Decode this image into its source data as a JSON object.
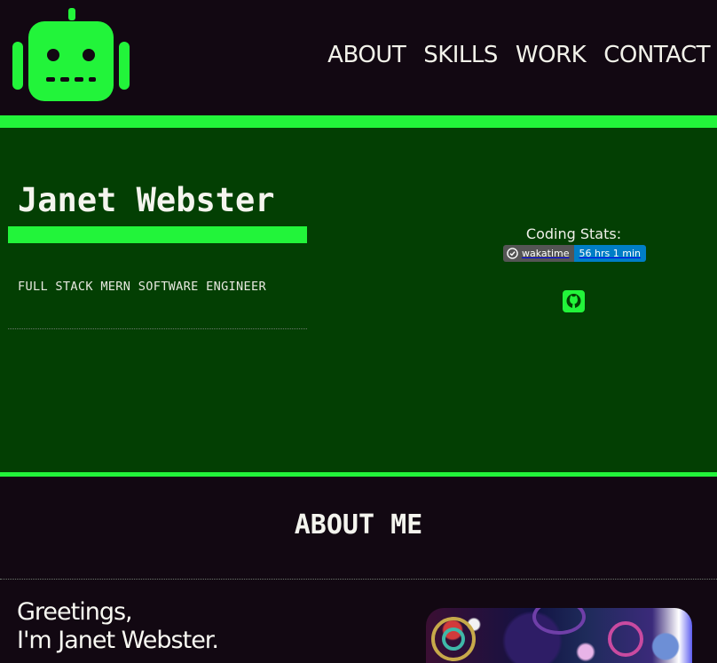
{
  "nav": {
    "items": [
      "ABOUT",
      "SKILLS",
      "WORK",
      "CONTACT"
    ]
  },
  "hero": {
    "name": "Janet Webster",
    "role": "FULL STACK MERN SOFTWARE ENGINEER",
    "stats_label": "Coding Stats:",
    "badge_left": "wakatime",
    "badge_right": "56 hrs 1 min"
  },
  "about": {
    "title": "ABOUT ME",
    "greeting_line1": "Greetings,",
    "greeting_line2": "I'm Janet Webster."
  },
  "colors": {
    "accent": "#22f43a",
    "hero_bg": "#033f03",
    "page_bg": "#120812"
  },
  "icons": [
    "robot-logo-icon",
    "clock-icon",
    "github-icon"
  ]
}
